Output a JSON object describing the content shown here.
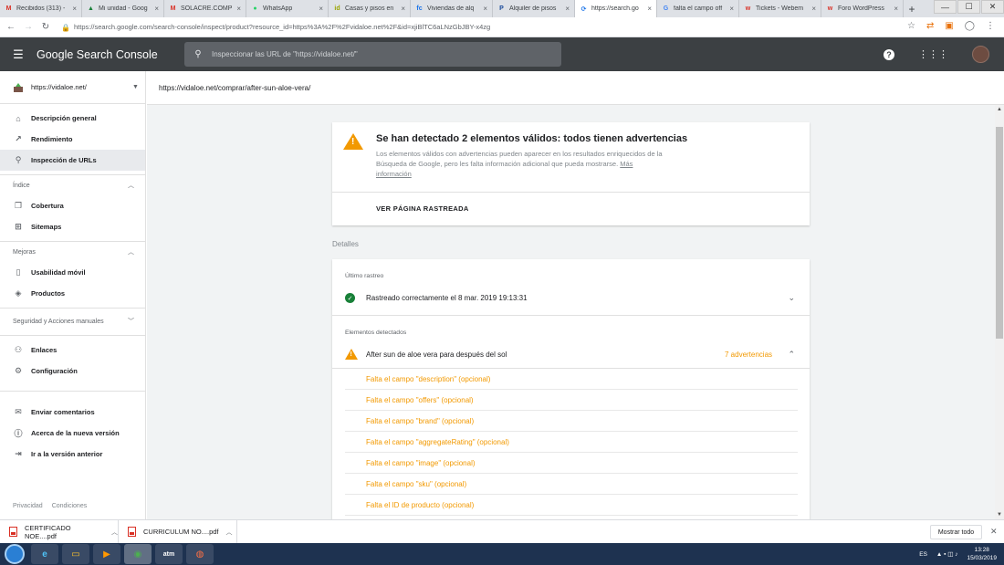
{
  "browser": {
    "tabs": [
      {
        "label": "Recibidos (313) -",
        "icon": "gmail-icon",
        "fav": "M",
        "favcolor": "#d93025",
        "active": false
      },
      {
        "label": "Mi unidad - Goog",
        "icon": "drive-icon",
        "fav": "▲",
        "favcolor": "#188038",
        "active": false
      },
      {
        "label": "SOLACRE.COMP",
        "icon": "gmail-icon",
        "fav": "M",
        "favcolor": "#d93025",
        "active": false
      },
      {
        "label": "WhatsApp",
        "icon": "whatsapp-icon",
        "fav": "●",
        "favcolor": "#25d366",
        "active": false
      },
      {
        "label": "Casas y pisos en",
        "icon": "idealista-icon",
        "fav": "id",
        "favcolor": "#9aa400",
        "active": false
      },
      {
        "label": "Viviendas de alq",
        "icon": "fc-icon",
        "fav": "fc",
        "favcolor": "#1a73e8",
        "active": false
      },
      {
        "label": "Alquiler de pisos",
        "icon": "pisos-icon",
        "fav": "P",
        "favcolor": "#1a4a9a",
        "active": false
      },
      {
        "label": "https://search.go",
        "icon": "gsc-icon",
        "fav": "⟳",
        "favcolor": "#1a73e8",
        "active": true
      },
      {
        "label": "falta el campo off",
        "icon": "google-icon",
        "fav": "G",
        "favcolor": "#4285f4",
        "active": false
      },
      {
        "label": "Tickets - Webem",
        "icon": "webempresa-icon",
        "fav": "w",
        "favcolor": "#d93025",
        "active": false
      },
      {
        "label": "Foro WordPress",
        "icon": "webempresa-icon",
        "fav": "w",
        "favcolor": "#d93025",
        "active": false
      }
    ],
    "new_tab": "+",
    "window_controls": {
      "minimize": "—",
      "maximize": "☐",
      "close": "✕"
    },
    "url": "https://search.google.com/search-console/inspect/product?resource_id=https%3A%2F%2Fvidaloe.net%2F&id=xjiBlTC6aLNzGbJBY-x4zg"
  },
  "gsc": {
    "brand": "Google Search Console",
    "search_placeholder": "Inspeccionar las URL de \"https://vidaloe.net/\"",
    "property": "https://vidaloe.net/",
    "inspected_url": "https://vidaloe.net/comprar/after-sun-aloe-vera/"
  },
  "sidebar": {
    "nav_top": [
      {
        "label": "Descripción general",
        "icon": "home-icon",
        "glyph": "⌂",
        "active": false
      },
      {
        "label": "Rendimiento",
        "icon": "trending-icon",
        "glyph": "↗",
        "active": false
      },
      {
        "label": "Inspección de URLs",
        "icon": "search-icon",
        "glyph": "⚲",
        "active": true
      }
    ],
    "section_index": "Índice",
    "nav_index": [
      {
        "label": "Cobertura",
        "icon": "copy-icon",
        "glyph": "❐"
      },
      {
        "label": "Sitemaps",
        "icon": "sitemap-icon",
        "glyph": "⊞"
      }
    ],
    "section_improvements": "Mejoras",
    "nav_improvements": [
      {
        "label": "Usabilidad móvil",
        "icon": "mobile-icon",
        "glyph": "▯"
      },
      {
        "label": "Productos",
        "icon": "product-icon",
        "glyph": "◈"
      }
    ],
    "section_security": "Seguridad y Acciones manuales",
    "nav_other": [
      {
        "label": "Enlaces",
        "icon": "links-icon",
        "glyph": "⚇"
      },
      {
        "label": "Configuración",
        "icon": "settings-icon",
        "glyph": "⚙"
      }
    ],
    "nav_bottom": [
      {
        "label": "Enviar comentarios",
        "icon": "feedback-icon",
        "glyph": "✉"
      },
      {
        "label": "Acerca de la nueva versión",
        "icon": "info-icon",
        "glyph": "ⓘ"
      },
      {
        "label": "Ir a la versión anterior",
        "icon": "exit-icon",
        "glyph": "⇥"
      }
    ],
    "footer_privacy": "Privacidad",
    "footer_terms": "Condiciones"
  },
  "summary_card": {
    "title": "Se han detectado 2 elementos válidos: todos tienen advertencias",
    "description": "Los elementos válidos con advertencias pueden aparecer en los resultados enriquecidos de la Búsqueda de Google, pero les falta información adicional que pueda mostrarse.",
    "more_link": "Más información",
    "button": "VER PÁGINA RASTREADA"
  },
  "details": {
    "heading": "Detalles",
    "last_crawl_label": "Último rastreo",
    "last_crawl_text": "Rastreado correctamente el 8 mar. 2019 19:13:31",
    "detected_label": "Elementos detectados",
    "item_name": "After sun de aloe vera para después del sol",
    "warning_count": "7 advertencias",
    "issues": [
      "Falta el campo \"description\" (opcional)",
      "Falta el campo \"offers\" (opcional)",
      "Falta el campo \"brand\" (opcional)",
      "Falta el campo \"aggregateRating\" (opcional)",
      "Falta el campo \"image\" (opcional)",
      "Falta el campo \"sku\" (opcional)",
      "Falta el ID de producto (opcional)"
    ],
    "warning_color": "#f29900",
    "ok_color": "#188038"
  },
  "downloads": {
    "items": [
      "CERTIFICADO NOE....pdf",
      "CURRICULUM NO....pdf"
    ],
    "show_all": "Mostrar todo"
  },
  "taskbar": {
    "lang": "ES",
    "time": "13:28",
    "date": "15/03/2019"
  }
}
